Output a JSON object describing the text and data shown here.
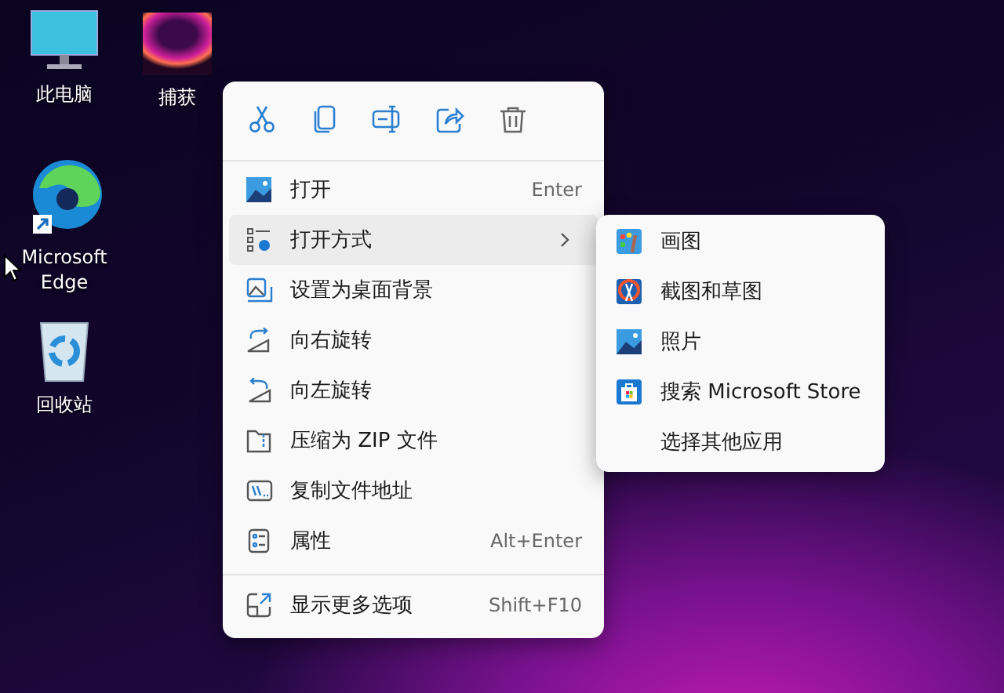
{
  "desktop_icons": [
    {
      "label": "此电脑",
      "kind": "monitor"
    },
    {
      "label": "捕获",
      "kind": "image"
    },
    {
      "label": "Microsoft Edge",
      "kind": "edge"
    },
    {
      "label": "回收站",
      "kind": "recycle"
    }
  ],
  "context_menu": {
    "items": [
      {
        "label": "打开",
        "shortcut": "Enter",
        "kind": "command",
        "selected": false
      },
      {
        "label": "打开方式",
        "kind": "submenu",
        "selected": true
      },
      {
        "label": "设置为桌面背景",
        "kind": "command",
        "selected": false
      },
      {
        "label": "向右旋转",
        "kind": "command",
        "selected": false
      },
      {
        "label": "向左旋转",
        "kind": "command",
        "selected": false
      },
      {
        "label": "压缩为 ZIP 文件",
        "kind": "command",
        "selected": false
      },
      {
        "label": "复制文件地址",
        "kind": "command",
        "selected": false
      },
      {
        "label": "属性",
        "shortcut": "Alt+Enter",
        "kind": "command",
        "selected": false
      }
    ],
    "footer_item": {
      "label": "显示更多选项",
      "shortcut": "Shift+F10"
    }
  },
  "submenu": {
    "items": [
      {
        "label": "画图",
        "kind": "paint"
      },
      {
        "label": "截图和草图",
        "kind": "snip"
      },
      {
        "label": "照片",
        "kind": "photos"
      },
      {
        "label": "搜索 Microsoft Store",
        "kind": "store"
      },
      {
        "label": "选择其他应用",
        "kind": "none"
      }
    ]
  }
}
